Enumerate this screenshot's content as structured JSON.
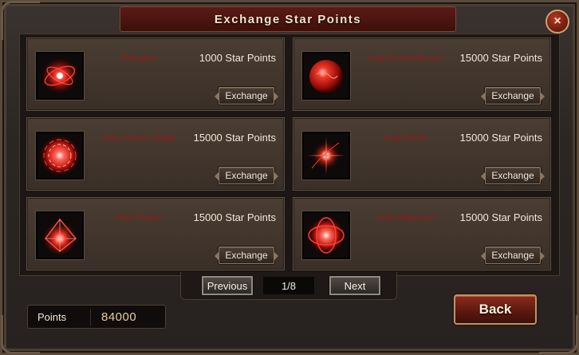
{
  "window": {
    "title": "Exchange Star Points",
    "close_label": "×"
  },
  "items": [
    {
      "name": "Energine",
      "cost": "1000 Star Points",
      "button": "Exchange",
      "icon": "swirl-orb-icon"
    },
    {
      "name": "Holy Enshieldment",
      "cost": "15000 Star Points",
      "button": "Exchange",
      "icon": "red-sphere-icon"
    },
    {
      "name": "Holy Sniper's Edge",
      "cost": "15000 Star Points",
      "button": "Exchange",
      "icon": "vortex-orb-icon"
    },
    {
      "name": "Holy Force",
      "cost": "15000 Star Points",
      "button": "Exchange",
      "icon": "spark-burst-icon"
    },
    {
      "name": "Holy Charm",
      "cost": "15000 Star Points",
      "button": "Exchange",
      "icon": "red-crystal-icon"
    },
    {
      "name": "Holy Willpower",
      "cost": "15000 Star Points",
      "button": "Exchange",
      "icon": "ring-orb-icon"
    }
  ],
  "pager": {
    "previous_label": "Previous",
    "page": "1/8",
    "next_label": "Next"
  },
  "points": {
    "label": "Points",
    "value": "84000"
  },
  "back_label": "Back",
  "colors": {
    "item_name": "#8e1c14",
    "title_bar": "#4a1510",
    "accent_gold": "#b89468"
  }
}
